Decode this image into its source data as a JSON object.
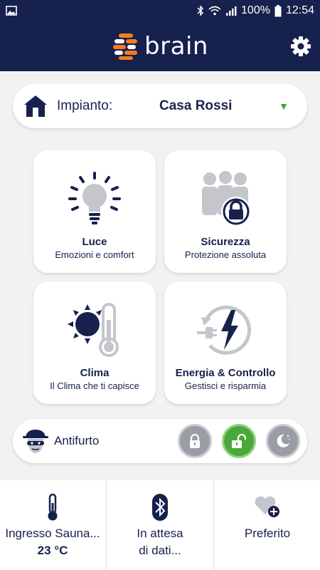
{
  "status_bar": {
    "battery": "100%",
    "time": "12:54"
  },
  "app": {
    "brand": "brain"
  },
  "plant": {
    "label": "Impianto:",
    "value": "Casa Rossi",
    "arrow": "▼"
  },
  "tiles": [
    {
      "title": "Luce",
      "subtitle": "Emozioni e comfort",
      "icon": "lightbulb-icon"
    },
    {
      "title": "Sicurezza",
      "subtitle": "Protezione assoluta",
      "icon": "people-lock-icon"
    },
    {
      "title": "Clima",
      "subtitle": "Il Clima che ti capisce",
      "icon": "sun-thermometer-icon"
    },
    {
      "title": "Energia & Controllo",
      "subtitle": "Gestisci e risparmia",
      "icon": "energy-plug-icon"
    }
  ],
  "alarm": {
    "label": "Antifurto",
    "modes": [
      "lock",
      "unlock",
      "night"
    ],
    "active": "unlock"
  },
  "bottom": [
    {
      "line1": "Ingresso Sauna...",
      "line2": "23 °C",
      "icon": "thermometer-icon"
    },
    {
      "line1": "In attesa",
      "line2": "di dati...",
      "icon": "bluetooth-icon"
    },
    {
      "line1": "Preferito",
      "line2": "",
      "icon": "heart-plus-icon"
    }
  ],
  "colors": {
    "navy": "#16214d",
    "green": "#4aa83a",
    "orange": "#f47c20",
    "grey": "#9a9da6"
  }
}
